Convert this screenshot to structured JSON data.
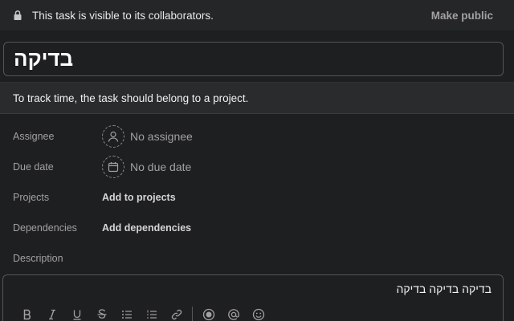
{
  "visibility": {
    "message": "This task is visible to its collaborators.",
    "make_public_label": "Make public",
    "icon": "lock-icon"
  },
  "task": {
    "title": "בדיקה"
  },
  "notice": {
    "text": "To track time, the task should belong to a project."
  },
  "fields": {
    "assignee": {
      "label": "Assignee",
      "value": "No assignee",
      "icon": "person-icon"
    },
    "due_date": {
      "label": "Due date",
      "value": "No due date",
      "icon": "calendar-icon"
    },
    "projects": {
      "label": "Projects",
      "value": "Add to projects"
    },
    "dependencies": {
      "label": "Dependencies",
      "value": "Add dependencies"
    },
    "description": {
      "label": "Description"
    }
  },
  "description": {
    "text": "בדיקה בדיקה בדיקה"
  },
  "toolbar": {
    "items": [
      "bold-icon",
      "italic-icon",
      "underline-icon",
      "strikethrough-icon",
      "bulleted-list-icon",
      "numbered-list-icon",
      "link-icon",
      "record-icon",
      "mention-icon",
      "emoji-icon"
    ]
  },
  "colors": {
    "background": "#1e1f21",
    "banner": "#252628",
    "muted_text": "#a2a0a2",
    "border": "#565557"
  }
}
